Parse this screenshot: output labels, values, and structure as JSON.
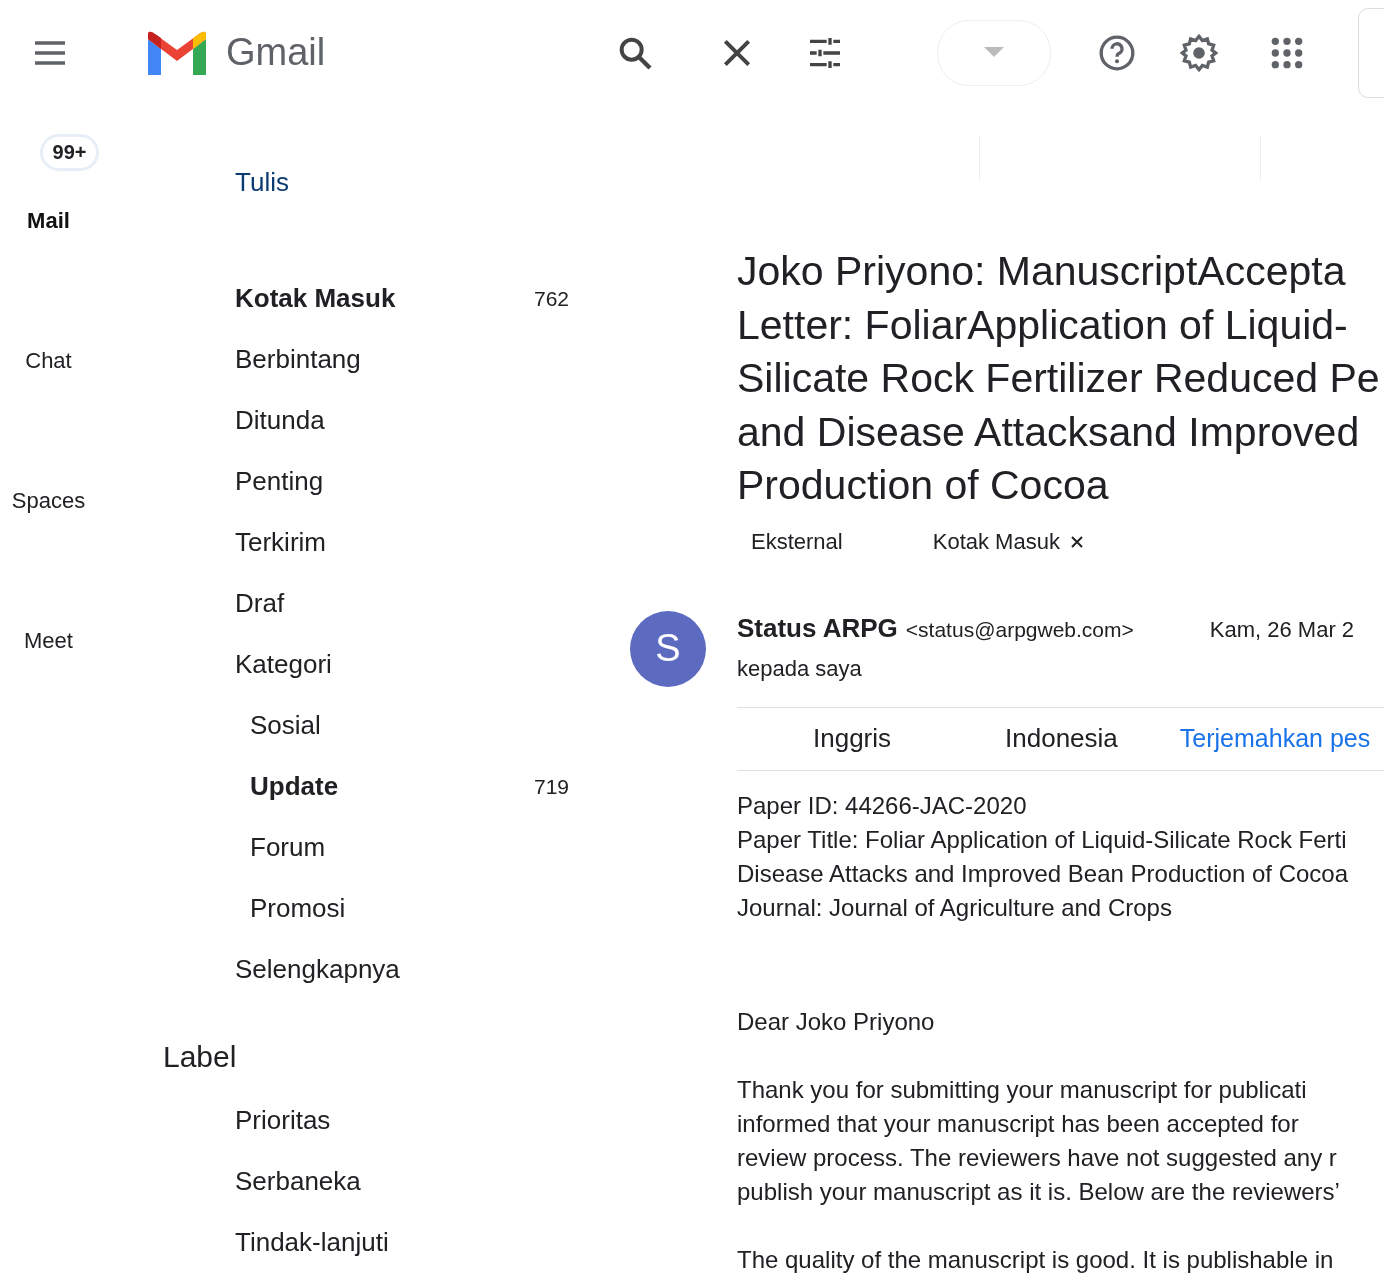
{
  "header": {
    "app_name": "Gmail"
  },
  "rail": {
    "badge": "99+",
    "items": [
      {
        "label": "Mail",
        "selected": true
      },
      {
        "label": "Chat",
        "selected": false
      },
      {
        "label": "Spaces",
        "selected": false
      },
      {
        "label": "Meet",
        "selected": false
      }
    ]
  },
  "nav": {
    "compose": "Tulis",
    "folders": [
      {
        "label": "Kotak Masuk",
        "count": "762",
        "unread": true
      },
      {
        "label": "Berbintang",
        "unread": false
      },
      {
        "label": "Ditunda",
        "unread": false
      },
      {
        "label": "Penting",
        "unread": false
      },
      {
        "label": "Terkirim",
        "unread": false
      },
      {
        "label": "Draf",
        "unread": false
      },
      {
        "label": "Kategori",
        "unread": false,
        "children": [
          {
            "label": "Sosial",
            "unread": false
          },
          {
            "label": "Update",
            "count": "719",
            "unread": true
          },
          {
            "label": "Forum",
            "unread": false
          },
          {
            "label": "Promosi",
            "unread": false
          }
        ]
      },
      {
        "label": "Selengkapnya",
        "unread": false
      }
    ],
    "labels_heading": "Label",
    "labels": [
      "Prioritas",
      "Serbaneka",
      "Tindak-lanjuti"
    ]
  },
  "message": {
    "subject_lines": [
      "Joko Priyono: ManuscriptAccepta",
      "Letter: FoliarApplication of Liquid-",
      "Silicate Rock Fertilizer Reduced Pe",
      "and Disease Attacksand Improved",
      "Production of Cocoa"
    ],
    "tags": [
      {
        "label": "Eksternal",
        "removable": false
      },
      {
        "label": "Kotak Masuk",
        "removable": true
      }
    ],
    "sender": {
      "initial": "S",
      "name": "Status ARPG",
      "email": "<status@arpgweb.com>",
      "date": "Kam, 26 Mar 2",
      "recipient": "kepada saya"
    },
    "translate": {
      "languages": [
        "Inggris",
        "Indonesia"
      ],
      "link": "Terjemahkan pes"
    },
    "info_lines": [
      "Paper ID: 44266-JAC-2020",
      "Paper Title: Foliar Application of Liquid-Silicate Rock Ferti",
      "Disease Attacks and Improved Bean Production of Cocoa",
      "Journal: Journal of Agriculture and Crops"
    ],
    "greeting": "Dear Joko Priyono",
    "paragraph_lines": [
      "Thank you for submitting your manuscript for publicati",
      "informed that your manuscript has been accepted for",
      "review process. The reviewers have not suggested any r",
      "publish your manuscript as it is. Below are the reviewers’"
    ],
    "last_line": "The quality of the manuscript is good.  It is publishable in"
  }
}
